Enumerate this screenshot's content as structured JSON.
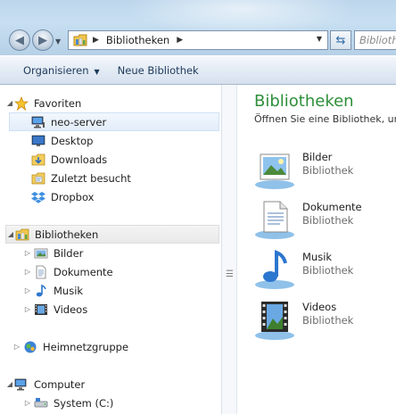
{
  "address": {
    "crumb": "Bibliotheken",
    "search_placeholder": "Bibliothe"
  },
  "commandbar": {
    "organize_label": "Organisieren",
    "new_library_label": "Neue Bibliothek"
  },
  "navigation": {
    "favorites": {
      "label": "Favoriten",
      "items": [
        {
          "label": "neo-server",
          "icon": "network-computer-icon"
        },
        {
          "label": "Desktop",
          "icon": "desktop-icon"
        },
        {
          "label": "Downloads",
          "icon": "downloads-folder-icon"
        },
        {
          "label": "Zuletzt besucht",
          "icon": "recent-places-icon"
        },
        {
          "label": "Dropbox",
          "icon": "dropbox-icon"
        }
      ]
    },
    "libraries": {
      "label": "Bibliotheken",
      "items": [
        {
          "label": "Bilder",
          "icon": "pictures-icon"
        },
        {
          "label": "Dokumente",
          "icon": "documents-icon"
        },
        {
          "label": "Musik",
          "icon": "music-icon"
        },
        {
          "label": "Videos",
          "icon": "videos-icon"
        }
      ]
    },
    "homegroup": {
      "label": "Heimnetzgruppe"
    },
    "computer": {
      "label": "Computer",
      "items": [
        {
          "label": "System (C:)",
          "icon": "drive-icon"
        }
      ]
    }
  },
  "content": {
    "title": "Bibliotheken",
    "subtitle": "Öffnen Sie eine Bibliothek, um",
    "libraries": [
      {
        "name": "Bilder",
        "type": "Bibliothek",
        "icon": "pictures-library-icon"
      },
      {
        "name": "Dokumente",
        "type": "Bibliothek",
        "icon": "documents-library-icon"
      },
      {
        "name": "Musik",
        "type": "Bibliothek",
        "icon": "music-library-icon"
      },
      {
        "name": "Videos",
        "type": "Bibliothek",
        "icon": "videos-library-icon"
      }
    ]
  },
  "colors": {
    "title_green": "#2e8f3a",
    "command_text": "#1e395b",
    "selection_bg": "#e2edfa"
  }
}
